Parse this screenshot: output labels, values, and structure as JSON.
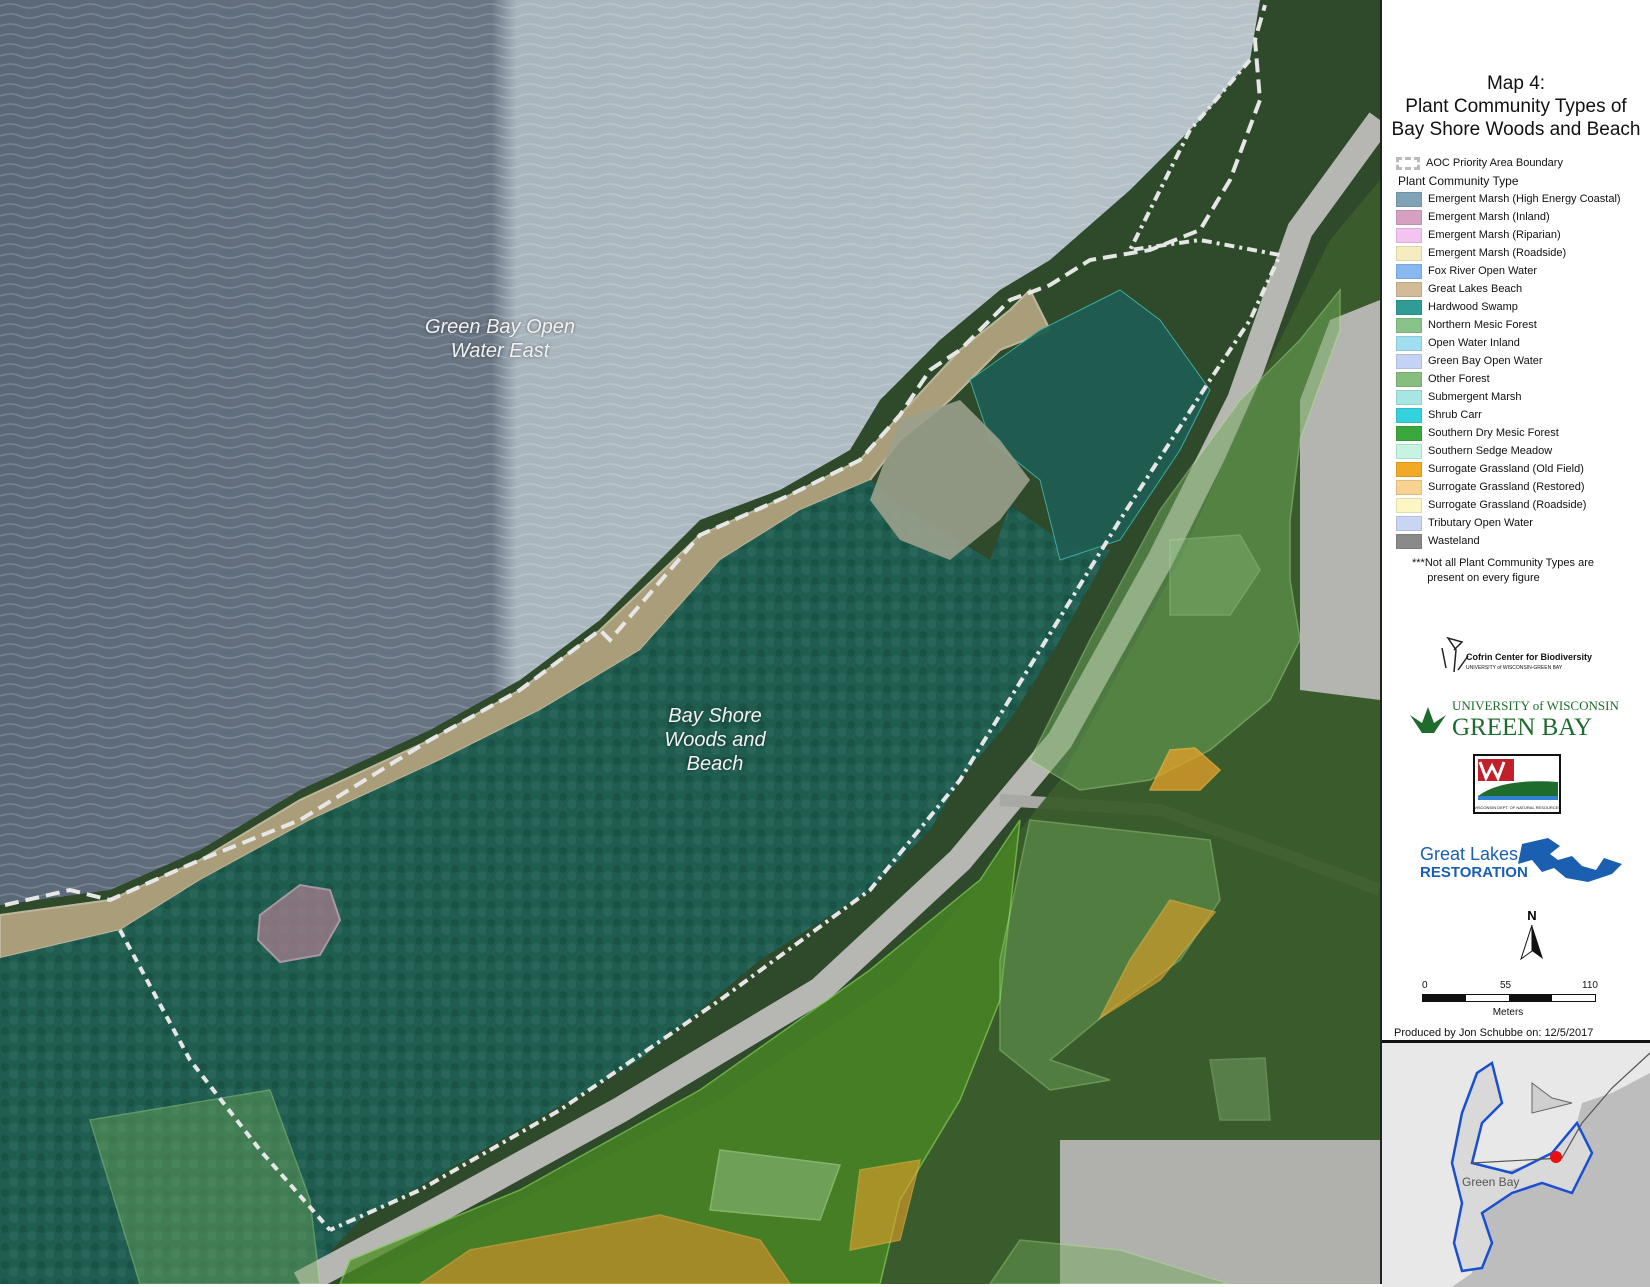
{
  "map": {
    "labels": {
      "water": "Green Bay Open\nWater East",
      "park": "Bay Shore\nWoods and\nBeach"
    }
  },
  "panel": {
    "title": "Map 4:\nPlant Community Types of\nBay Shore Woods and Beach",
    "boundary_label": "AOC Priority Area Boundary",
    "legend_heading": "Plant Community Type",
    "legend": [
      {
        "label": "Emergent Marsh (High Energy Coastal)",
        "color": "#7ea3b6"
      },
      {
        "label": "Emergent Marsh (Inland)",
        "color": "#d6a0c0"
      },
      {
        "label": "Emergent Marsh (Riparian)",
        "color": "#f4c4f0"
      },
      {
        "label": "Emergent Marsh (Roadside)",
        "color": "#f6ecc0"
      },
      {
        "label": "Fox River Open Water",
        "color": "#88b8f0"
      },
      {
        "label": "Great Lakes Beach",
        "color": "#d2bc98"
      },
      {
        "label": "Hardwood Swamp",
        "color": "#2f9c96"
      },
      {
        "label": "Northern Mesic Forest",
        "color": "#88c48a"
      },
      {
        "label": "Open Water Inland",
        "color": "#a0def0"
      },
      {
        "label": "Green Bay Open Water",
        "color": "#c4d2f4"
      },
      {
        "label": "Other Forest",
        "color": "#86be7e"
      },
      {
        "label": "Submergent Marsh",
        "color": "#a8e6e4"
      },
      {
        "label": "Shrub Carr",
        "color": "#34d2dc"
      },
      {
        "label": "Southern Dry Mesic Forest",
        "color": "#3aa83c"
      },
      {
        "label": "Southern Sedge Meadow",
        "color": "#c6f4e2"
      },
      {
        "label": "Surrogate Grassland (Old Field)",
        "color": "#f2aa24"
      },
      {
        "label": "Surrogate Grassland (Restored)",
        "color": "#f8d290"
      },
      {
        "label": "Surrogate Grassland (Roadside)",
        "color": "#fcf6c4"
      },
      {
        "label": "Tributary Open Water",
        "color": "#c8d6f4"
      },
      {
        "label": "Wasteland",
        "color": "#8a8a8a"
      }
    ],
    "note": "***Not all Plant Community Types are\n     present on every figure",
    "logos": {
      "cofrin": "Cofrin Center for Biodiversity",
      "cofrin_sub": "UNIVERSITY of WISCONSIN-GREEN BAY",
      "uwgb_top": "UNIVERSITY of WISCONSIN",
      "uwgb_main": "GREEN BAY",
      "dnr": "WISCONSIN DEPT. OF NATURAL RESOURCES",
      "glr_top": "Great Lakes",
      "glr_bottom": "RESTORATION"
    },
    "north": "N",
    "scale": {
      "ticks": [
        "0",
        "55",
        "110"
      ],
      "unit": "Meters"
    },
    "produced": "Produced by Jon Schubbe on: 12/5/2017",
    "inset_label": "Green Bay"
  }
}
